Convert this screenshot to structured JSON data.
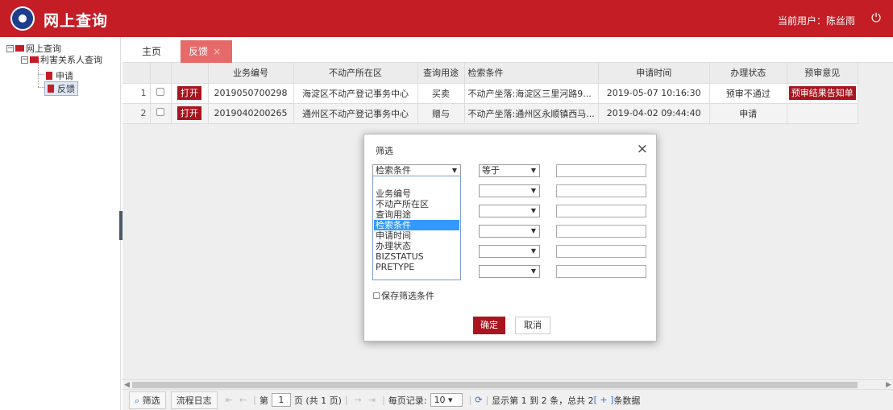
{
  "header": {
    "app_title": "网上查询",
    "user_label": "当前用户：陈丝雨",
    "icons": {
      "logo": "app-logo",
      "power": "power-icon"
    }
  },
  "tree": {
    "root": "网上查询",
    "group": "利害关系人查询",
    "items": [
      "申请",
      "反馈"
    ],
    "selected": "反馈"
  },
  "tabs": [
    {
      "label": "主页",
      "active": false
    },
    {
      "label": "反馈",
      "active": true,
      "close": "×"
    }
  ],
  "grid": {
    "columns": [
      "",
      "",
      "",
      "业务编号",
      "不动产所在区",
      "查询用途",
      "检索条件",
      "申请时间",
      "办理状态",
      "预审意见"
    ],
    "rows": [
      {
        "num": "1",
        "open": "打开",
        "biz_no": "2019050700298",
        "district": "海淀区不动产登记事务中心",
        "purpose": "买卖",
        "condition": "不动产坐落:海淀区三里河路9...",
        "apply_time": "2019-05-07 10:16:30",
        "status": "预审不通过",
        "pre_opinion": "预审结果告知单"
      },
      {
        "num": "2",
        "open": "打开",
        "biz_no": "2019040200265",
        "district": "通州区不动产登记事务中心",
        "purpose": "赠与",
        "condition": "不动产坐落:通州区永顺镇西马...",
        "apply_time": "2019-04-02 09:44:40",
        "status": "申请",
        "pre_opinion": ""
      }
    ]
  },
  "dialog": {
    "title": "筛选",
    "close": "×",
    "field_selected": "检索条件",
    "operator_selected": "等于",
    "field_options": [
      "",
      "业务编号",
      "不动产所在区",
      "查询用途",
      "检索条件",
      "申请时间",
      "办理状态",
      "BIZSTATUS",
      "PRETYPE"
    ],
    "highlighted_option": "检索条件",
    "save_label": "保存筛选条件",
    "ok_label": "确定",
    "cancel_label": "取消"
  },
  "pager": {
    "filter_label": "筛选",
    "log_label": "流程日志",
    "page_prefix": "第",
    "page_value": "1",
    "page_suffix": "页 (共 1 页)",
    "per_page_label": "每页记录:",
    "per_page_value": "10",
    "info_prefix": "显示第 1 到 2 条，总共 2",
    "info_count": "[ + ]",
    "info_suffix": "条数据"
  },
  "colors": {
    "brand_red": "#c41d26",
    "button_red": "#a8151e",
    "active_tab": "#e66a6a",
    "select_blue": "#3399ff"
  }
}
